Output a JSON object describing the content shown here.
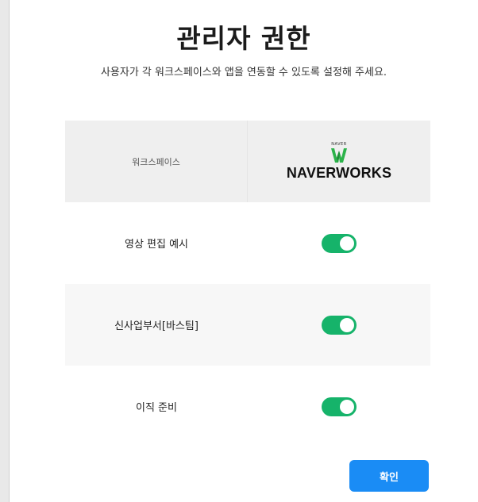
{
  "dialog": {
    "title": "관리자 권한",
    "subtitle": "사용자가 각 워크스페이스와 앱을 연동할 수 있도록 설정해 주세요."
  },
  "table": {
    "header_label": "워크스페이스",
    "app": {
      "brand_small": "NAVER",
      "brand_name": "NAVERWORKS",
      "icon": "naverworks-logo-icon",
      "brand_color": "#2cb34a"
    },
    "rows": [
      {
        "name": "영상 편집 예시",
        "enabled": true
      },
      {
        "name": "신사업부서[바스팀]",
        "enabled": true
      },
      {
        "name": "이직 준비",
        "enabled": true
      }
    ]
  },
  "footer": {
    "confirm_label": "확인"
  },
  "colors": {
    "toggle_on": "#16b36a",
    "confirm_button": "#1a8cf5"
  }
}
